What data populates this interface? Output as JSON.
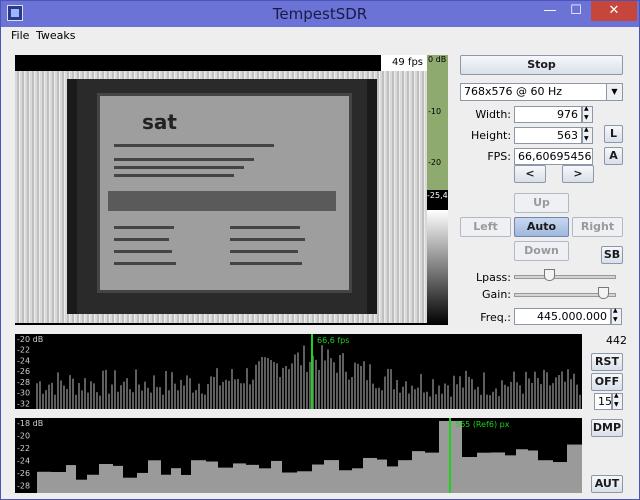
{
  "window": {
    "title": "TempestSDR",
    "min": "—",
    "max": "☐",
    "close": "✕"
  },
  "menu": [
    "File",
    "Tweaks"
  ],
  "video": {
    "fps": "49 fps",
    "logo": "sat",
    "db_labels": [
      "0 dB",
      "-10",
      "-20",
      "-25,4"
    ]
  },
  "controls": {
    "stop": "Stop",
    "resolution": "768x576 @ 60 Hz",
    "width_label": "Width:",
    "width_value": "976",
    "height_label": "Height:",
    "height_value": "563",
    "fps_label": "FPS:",
    "fps_value": "66,60695456",
    "L": "L",
    "A": "A",
    "prev": "<",
    "next": ">",
    "up": "Up",
    "left": "Left",
    "auto": "Auto",
    "right": "Right",
    "down": "Down",
    "sb": "SB",
    "lpass_label": "Lpass:",
    "lpass_level": 0.33,
    "gain_label": "Gain:",
    "gain_level": 0.92,
    "freq_label": "Freq.:",
    "freq_value": "445.000.000"
  },
  "spectrum1": {
    "ticks": [
      "-20 dB",
      "-22",
      "-24",
      "-26",
      "-28",
      "-30",
      "-32"
    ],
    "marker": "66,6 fps",
    "count": "442"
  },
  "spectrum2": {
    "ticks": [
      "-18 dB",
      "-20",
      "-22",
      "-24",
      "-26",
      "-28"
    ],
    "marker": "565 (Ref6) px"
  },
  "side": {
    "rst": "RST",
    "off": "OFF",
    "spin_value": "15",
    "dmp": "DMP",
    "aut": "AUT"
  },
  "colors": {
    "title_bar": "#6b73d6",
    "close": "#c7463c",
    "marker": "#1bd31b"
  }
}
